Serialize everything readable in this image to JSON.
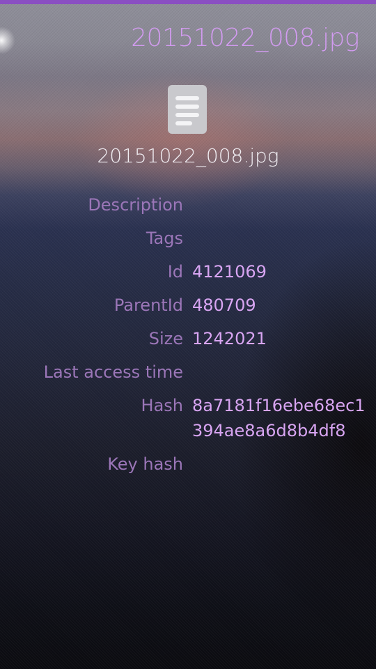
{
  "header": {
    "title": "20151022_008.jpg"
  },
  "file": {
    "icon": "document-icon",
    "name": "20151022_008.jpg"
  },
  "details": [
    {
      "label": "Description",
      "value": ""
    },
    {
      "label": "Tags",
      "value": ""
    },
    {
      "label": "Id",
      "value": "4121069"
    },
    {
      "label": "ParentId",
      "value": "480709"
    },
    {
      "label": "Size",
      "value": "1242021"
    },
    {
      "label": "Last access time",
      "value": ""
    },
    {
      "label": "Hash",
      "value": "8a7181f16ebe68ec1394ae8a6d8b4df8"
    },
    {
      "label": "Key hash",
      "value": ""
    }
  ],
  "colors": {
    "accent": "#8a4fc2",
    "title": "#d29bf0",
    "label": "#9b76b8",
    "value": "#d8a5f2"
  }
}
